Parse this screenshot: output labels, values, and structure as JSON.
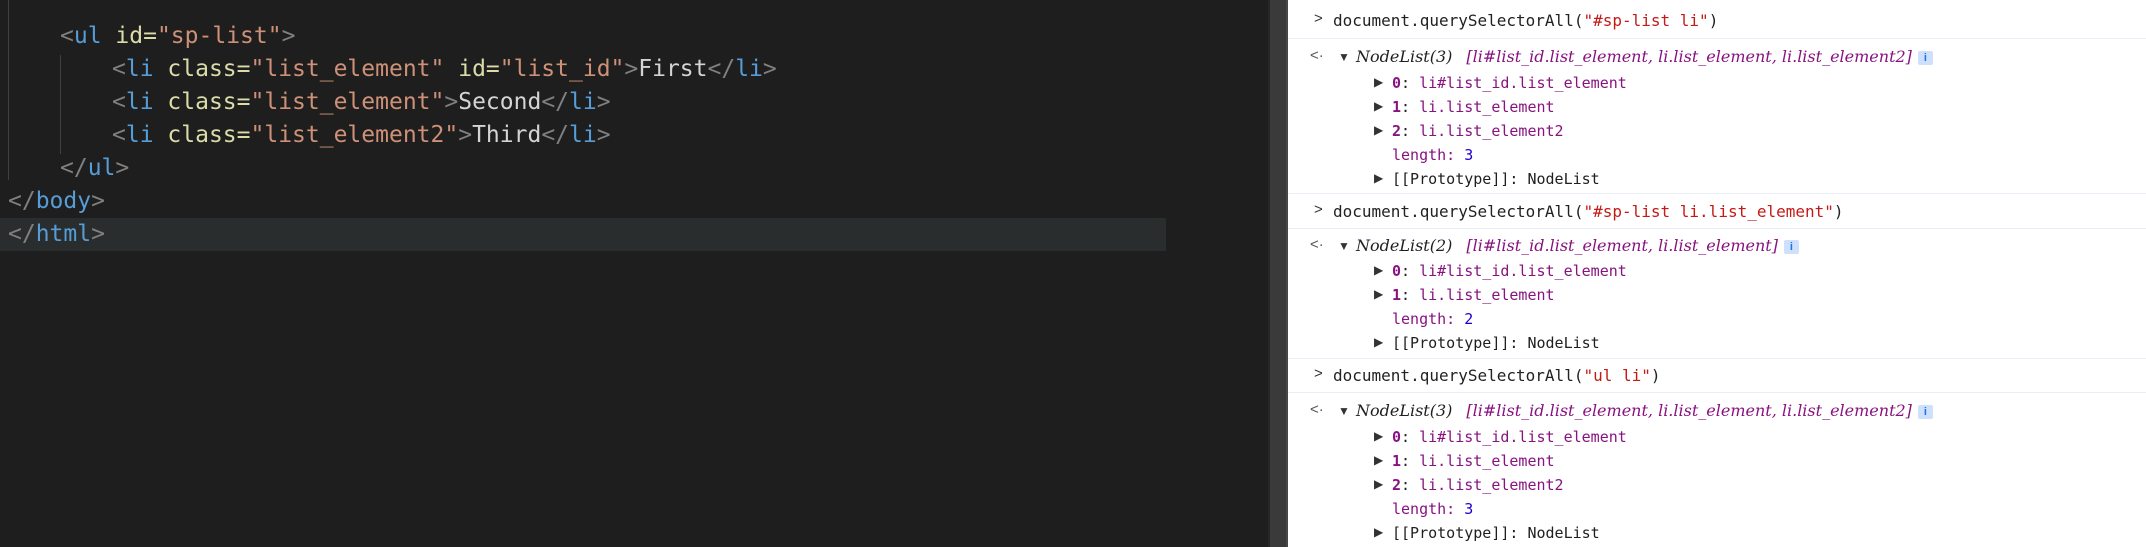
{
  "editor": {
    "lines": [
      {
        "tokens": [
          {
            "t": "<",
            "c": "tk-punc"
          },
          {
            "t": "ul",
            "c": "tk-tag"
          },
          {
            "t": " id=",
            "c": "tk-attr2"
          },
          {
            "t": "\"sp-list\"",
            "c": "tk-val"
          },
          {
            "t": ">",
            "c": "tk-punc"
          }
        ]
      },
      {
        "tokens": [
          {
            "t": "<",
            "c": "tk-punc"
          },
          {
            "t": "li",
            "c": "tk-tag"
          },
          {
            "t": " class=",
            "c": "tk-attr2"
          },
          {
            "t": "\"list_element\"",
            "c": "tk-val"
          },
          {
            "t": " id=",
            "c": "tk-attr2"
          },
          {
            "t": "\"list_id\"",
            "c": "tk-val"
          },
          {
            "t": ">",
            "c": "tk-punc"
          },
          {
            "t": "First",
            "c": "tk-text"
          },
          {
            "t": "</",
            "c": "tk-punc"
          },
          {
            "t": "li",
            "c": "tk-tag"
          },
          {
            "t": ">",
            "c": "tk-punc"
          }
        ]
      },
      {
        "tokens": [
          {
            "t": "<",
            "c": "tk-punc"
          },
          {
            "t": "li",
            "c": "tk-tag"
          },
          {
            "t": " class=",
            "c": "tk-attr2"
          },
          {
            "t": "\"list_element\"",
            "c": "tk-val"
          },
          {
            "t": ">",
            "c": "tk-punc"
          },
          {
            "t": "Second",
            "c": "tk-text"
          },
          {
            "t": "</",
            "c": "tk-punc"
          },
          {
            "t": "li",
            "c": "tk-tag"
          },
          {
            "t": ">",
            "c": "tk-punc"
          }
        ]
      },
      {
        "tokens": [
          {
            "t": "<",
            "c": "tk-punc"
          },
          {
            "t": "li",
            "c": "tk-tag"
          },
          {
            "t": " class=",
            "c": "tk-attr2"
          },
          {
            "t": "\"list_element2\"",
            "c": "tk-val"
          },
          {
            "t": ">",
            "c": "tk-punc"
          },
          {
            "t": "Third",
            "c": "tk-text"
          },
          {
            "t": "</",
            "c": "tk-punc"
          },
          {
            "t": "li",
            "c": "tk-tag"
          },
          {
            "t": ">",
            "c": "tk-punc"
          }
        ]
      },
      {
        "tokens": [
          {
            "t": "</",
            "c": "tk-punc"
          },
          {
            "t": "ul",
            "c": "tk-tag"
          },
          {
            "t": ">",
            "c": "tk-punc"
          }
        ]
      },
      {
        "tokens": [
          {
            "t": "</",
            "c": "tk-punc"
          },
          {
            "t": "body",
            "c": "tk-tag"
          },
          {
            "t": ">",
            "c": "tk-punc"
          }
        ]
      },
      {
        "tokens": [
          {
            "t": "</",
            "c": "tk-punc"
          },
          {
            "t": "html",
            "c": "tk-tag"
          },
          {
            "t": ">",
            "c": "tk-punc"
          }
        ]
      }
    ]
  },
  "console": {
    "entries": [
      {
        "command_prefix": "document.querySelectorAll(",
        "command_arg": "\"#sp-list li\"",
        "command_suffix": ")",
        "result_type": "NodeList(3)",
        "result_items": "[li#list_id.list_element, li.list_element, li.list_element2]",
        "children": [
          {
            "index": "0",
            "value": "li#list_id.list_element"
          },
          {
            "index": "1",
            "value": "li.list_element"
          },
          {
            "index": "2",
            "value": "li.list_element2"
          }
        ],
        "length_label": "length: ",
        "length_value": "3",
        "prototype_label": "[[Prototype]]: NodeList"
      },
      {
        "command_prefix": "document.querySelectorAll(",
        "command_arg": "\"#sp-list li.list_element\"",
        "command_suffix": ")",
        "result_type": "NodeList(2)",
        "result_items": "[li#list_id.list_element, li.list_element]",
        "children": [
          {
            "index": "0",
            "value": "li#list_id.list_element"
          },
          {
            "index": "1",
            "value": "li.list_element"
          }
        ],
        "length_label": "length: ",
        "length_value": "2",
        "prototype_label": "[[Prototype]]: NodeList"
      },
      {
        "command_prefix": "document.querySelectorAll(",
        "command_arg": "\"ul li\"",
        "command_suffix": ")",
        "result_type": "NodeList(3)",
        "result_items": "[li#list_id.list_element, li.list_element, li.list_element2]",
        "children": [
          {
            "index": "0",
            "value": "li#list_id.list_element"
          },
          {
            "index": "1",
            "value": "li.list_element"
          },
          {
            "index": "2",
            "value": "li.list_element2"
          }
        ],
        "length_label": "length: ",
        "length_value": "3",
        "prototype_label": "[[Prototype]]: NodeList"
      }
    ]
  },
  "icons": {
    "prompt": "chevron-right-icon",
    "return": "return-arrow-icon",
    "expand": "triangle-expand-icon",
    "info": "info-icon"
  },
  "colors": {
    "editor_bg": "#1e1e1e",
    "console_bg": "#ffffff",
    "tag": "#569cd6",
    "string": "#ce9178",
    "node": "#881280"
  }
}
